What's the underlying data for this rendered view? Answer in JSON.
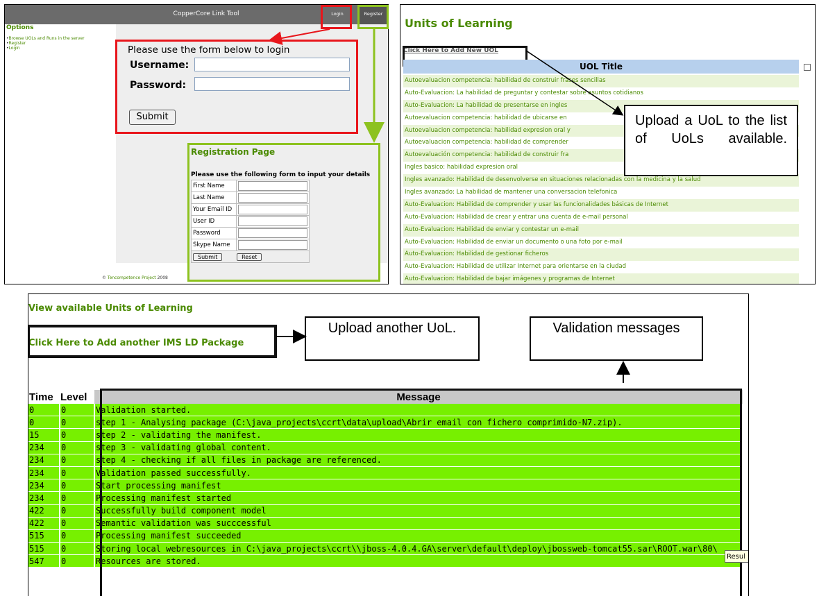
{
  "login_panel": {
    "app_title": "CopperCore Link Tool",
    "top_buttons": {
      "login": "Login",
      "register": "Register"
    },
    "options_heading": "Options",
    "options": [
      "Browse UOLs and Runs in the server",
      "Register",
      "Login"
    ],
    "login_form": {
      "intro": "Please use the form below to login",
      "username_label": "Username:",
      "password_label": "Password:",
      "submit_label": "Submit"
    },
    "registration": {
      "title": "Registration Page",
      "intro": "Please use the following form to input your details",
      "fields": [
        "First Name",
        "Last Name",
        "Your Email ID",
        "User ID",
        "Password",
        "Skype Name"
      ],
      "submit_label": "Submit",
      "reset_label": "Reset"
    },
    "footer": {
      "symbol": "©",
      "project": "Tencompetence Project",
      "year": "2008"
    },
    "highlight_colors": {
      "login": "#e8161c",
      "register": "#8dc21f"
    }
  },
  "uol_panel": {
    "heading": "Units of Learning",
    "add_link": "Click Here to Add New UOL",
    "column_header": "UOL Title",
    "titles": [
      "Autoevaluacion competencia: habilidad de construir frases sencillas",
      "Auto-Evaluacion: La habilidad de preguntar y contestar sobre asuntos cotidianos",
      "Auto-Evaluacion: La habilidad de presentarse en ingles",
      "Autoevaluacion competencia: habilidad de ubicarse en",
      "Autoevaluacion competencia: habilidad expresion oral y",
      "Autoevaluacion competencia: habilidad de comprender",
      "Autoevaluación competencia: habilidad de construir fra",
      "Ingles basico: habilidad expresion oral",
      "Ingles avanzado: Habilidad de desenvolverse en situaciones relacionadas con la medicina y la salud",
      "Ingles avanzado: La habilidad de mantener una conversacion telefonica",
      "Auto-Evaluacion: Habilidad de comprender y usar las funcionalidades básicas de Internet",
      "Auto-Evaluacion: Habilidad de crear y entrar una cuenta de e-mail personal",
      "Auto-Evaluacion: Habilidad de enviar y contestar un e-mail",
      "Auto-Evaluacion: Habilidad de enviar un documento o una foto por e-mail",
      "Auto-Evaluacion: Habilidad de gestionar ficheros",
      "Auto-Evaluacion: Habilidad de utilizar Internet para orientarse en la ciudad",
      "Auto-Evaluacion: Habilidad de bajar imágenes y programas de Internet"
    ],
    "callout": "Upload a UoL to the list of UoLs available."
  },
  "validation_panel": {
    "view_link": "View available Units of Learning",
    "add_link": "Click Here to Add another IMS LD Package",
    "callout_upload": "Upload another UoL.",
    "callout_validation": "Validation messages",
    "columns": {
      "time": "Time",
      "level": "Level",
      "message": "Message"
    },
    "rows": [
      {
        "time": "0",
        "level": "0",
        "message": "Validation started."
      },
      {
        "time": "0",
        "level": "0",
        "message": "step 1 - Analysing package (C:\\java_projects\\ccrt\\data\\upload\\Abrir email con fichero comprimido-N7.zip)."
      },
      {
        "time": "15",
        "level": "0",
        "message": "step 2 - validating the manifest."
      },
      {
        "time": "234",
        "level": "0",
        "message": "step 3 - validating global content."
      },
      {
        "time": "234",
        "level": "0",
        "message": "step 4 - checking if all files in package are referenced."
      },
      {
        "time": "234",
        "level": "0",
        "message": "Validation passed successfully."
      },
      {
        "time": "234",
        "level": "0",
        "message": "Start processing manifest"
      },
      {
        "time": "234",
        "level": "0",
        "message": "Processing manifest started"
      },
      {
        "time": "422",
        "level": "0",
        "message": "Successfully build component model"
      },
      {
        "time": "422",
        "level": "0",
        "message": "Semantic validation was succcessful"
      },
      {
        "time": "515",
        "level": "0",
        "message": "Processing manifest succeeded"
      },
      {
        "time": "515",
        "level": "0",
        "message": "Storing local webresources in C:\\java_projects\\ccrt\\\\jboss-4.0.4.GA\\server\\default\\deploy\\jbossweb-tomcat55.sar\\ROOT.war\\80\\"
      },
      {
        "time": "547",
        "level": "0",
        "message": "Resources are stored."
      }
    ],
    "tooltip": "Resul",
    "row_color": "#77f000"
  }
}
